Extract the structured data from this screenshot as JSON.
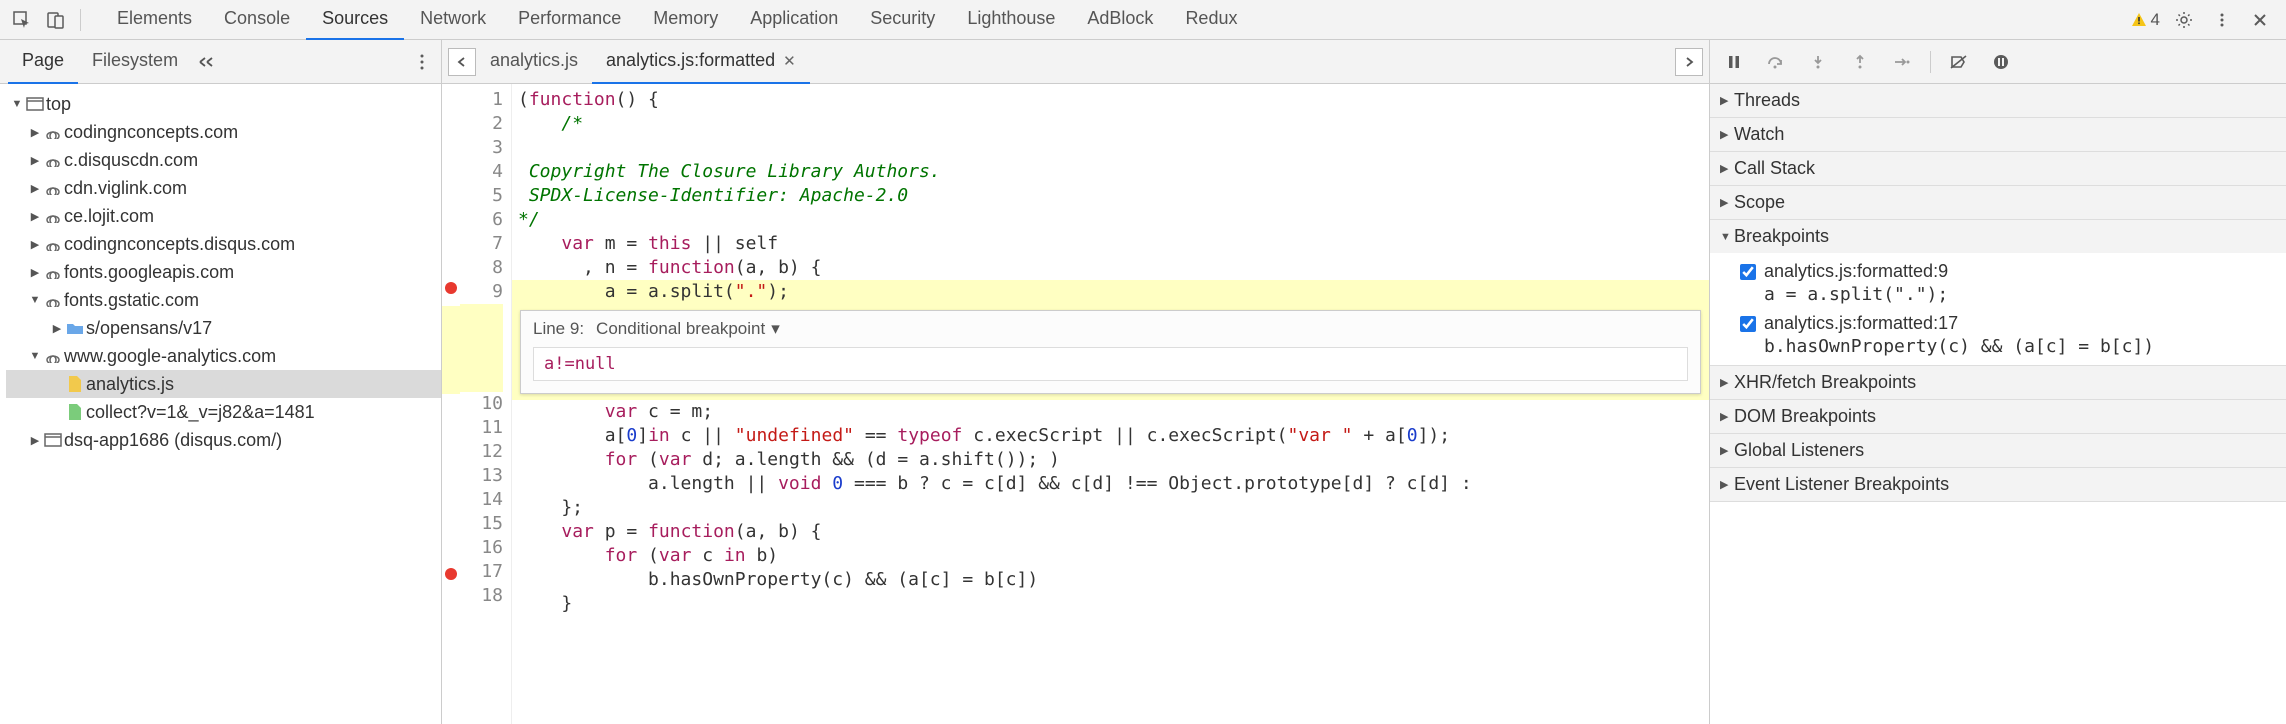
{
  "toolbar": {
    "tabs": [
      "Elements",
      "Console",
      "Sources",
      "Network",
      "Performance",
      "Memory",
      "Application",
      "Security",
      "Lighthouse",
      "AdBlock",
      "Redux"
    ],
    "active_tab": "Sources",
    "warning_count": "4"
  },
  "left_pane": {
    "tabs": [
      "Page",
      "Filesystem"
    ],
    "active_tab": "Page",
    "tree": [
      {
        "type": "frame",
        "label": "top",
        "expanded": true,
        "indent": 0
      },
      {
        "type": "domain",
        "label": "codingnconcepts.com",
        "expanded": false,
        "indent": 1
      },
      {
        "type": "domain",
        "label": "c.disquscdn.com",
        "expanded": false,
        "indent": 1
      },
      {
        "type": "domain",
        "label": "cdn.viglink.com",
        "expanded": false,
        "indent": 1
      },
      {
        "type": "domain",
        "label": "ce.lojit.com",
        "expanded": false,
        "indent": 1
      },
      {
        "type": "domain",
        "label": "codingnconcepts.disqus.com",
        "expanded": false,
        "indent": 1
      },
      {
        "type": "domain",
        "label": "fonts.googleapis.com",
        "expanded": false,
        "indent": 1
      },
      {
        "type": "domain",
        "label": "fonts.gstatic.com",
        "expanded": true,
        "indent": 1
      },
      {
        "type": "folder",
        "label": "s/opensans/v17",
        "expanded": false,
        "indent": 2
      },
      {
        "type": "domain",
        "label": "www.google-analytics.com",
        "expanded": true,
        "indent": 1
      },
      {
        "type": "file-js",
        "label": "analytics.js",
        "selected": true,
        "indent": 2
      },
      {
        "type": "file-other",
        "label": "collect?v=1&_v=j82&a=1481",
        "indent": 2
      },
      {
        "type": "frame",
        "label": "dsq-app1686 (disqus.com/)",
        "expanded": false,
        "indent": 1
      }
    ]
  },
  "file_tabs": {
    "tabs": [
      {
        "label": "analytics.js",
        "active": false,
        "closable": false
      },
      {
        "label": "analytics.js:formatted",
        "active": true,
        "closable": true
      }
    ]
  },
  "editor": {
    "breakpoint_lines": [
      9,
      17
    ],
    "lines": [
      {
        "n": 1,
        "html": "(<span class='kw'>function</span>() {"
      },
      {
        "n": 2,
        "html": "    <span class='cm'>/*</span>"
      },
      {
        "n": 3,
        "html": ""
      },
      {
        "n": 4,
        "html": " <span class='cm'>Copyright The Closure Library Authors.</span>"
      },
      {
        "n": 5,
        "html": " <span class='cm'>SPDX-License-Identifier: Apache-2.0</span>"
      },
      {
        "n": 6,
        "html": "<span class='cm'>*/</span>"
      },
      {
        "n": 7,
        "html": "    <span class='kw'>var</span> m = <span class='kw'>this</span> || self"
      },
      {
        "n": 8,
        "html": "      , n = <span class='kw'>function</span>(a, b) {"
      },
      {
        "n": 9,
        "html": "        a = a.split(<span class='str'>\".\"</span>);",
        "hl": true
      }
    ],
    "cond": {
      "line_label": "Line 9:",
      "type_label": "Conditional breakpoint",
      "value": "a!=null"
    },
    "lines2": [
      {
        "n": 10,
        "html": "        <span class='kw'>var</span> c = m;"
      },
      {
        "n": 11,
        "html": "        a[<span class='num'>0</span>]<span class='kw'>in</span> c || <span class='str'>\"undefined\"</span> == <span class='kw'>typeof</span> c.execScript || c.execScript(<span class='str'>\"var \"</span> + a[<span class='num'>0</span>]);"
      },
      {
        "n": 12,
        "html": "        <span class='kw'>for</span> (<span class='kw'>var</span> d; a.length && (d = a.shift()); )"
      },
      {
        "n": 13,
        "html": "            a.length || <span class='kw'>void</span> <span class='num'>0</span> === b ? c = c[d] && c[d] !== Object.prototype[d] ? c[d] :"
      },
      {
        "n": 14,
        "html": "    };"
      },
      {
        "n": 15,
        "html": "    <span class='kw'>var</span> p = <span class='kw'>function</span>(a, b) {"
      },
      {
        "n": 16,
        "html": "        <span class='kw'>for</span> (<span class='kw'>var</span> c <span class='kw'>in</span> b)"
      },
      {
        "n": 17,
        "html": "            b.hasOwnProperty(c) && (a[c] = b[c])"
      },
      {
        "n": 18,
        "html": "    }"
      }
    ]
  },
  "right_pane": {
    "sections": [
      {
        "label": "Threads",
        "open": false
      },
      {
        "label": "Watch",
        "open": false
      },
      {
        "label": "Call Stack",
        "open": false
      },
      {
        "label": "Scope",
        "open": false
      },
      {
        "label": "Breakpoints",
        "open": true,
        "items": [
          {
            "checked": true,
            "title": "analytics.js:formatted:9",
            "code": "a = a.split(\".\");"
          },
          {
            "checked": true,
            "title": "analytics.js:formatted:17",
            "code": "b.hasOwnProperty(c) && (a[c] = b[c])"
          }
        ]
      },
      {
        "label": "XHR/fetch Breakpoints",
        "open": false
      },
      {
        "label": "DOM Breakpoints",
        "open": false
      },
      {
        "label": "Global Listeners",
        "open": false
      },
      {
        "label": "Event Listener Breakpoints",
        "open": false
      }
    ]
  }
}
